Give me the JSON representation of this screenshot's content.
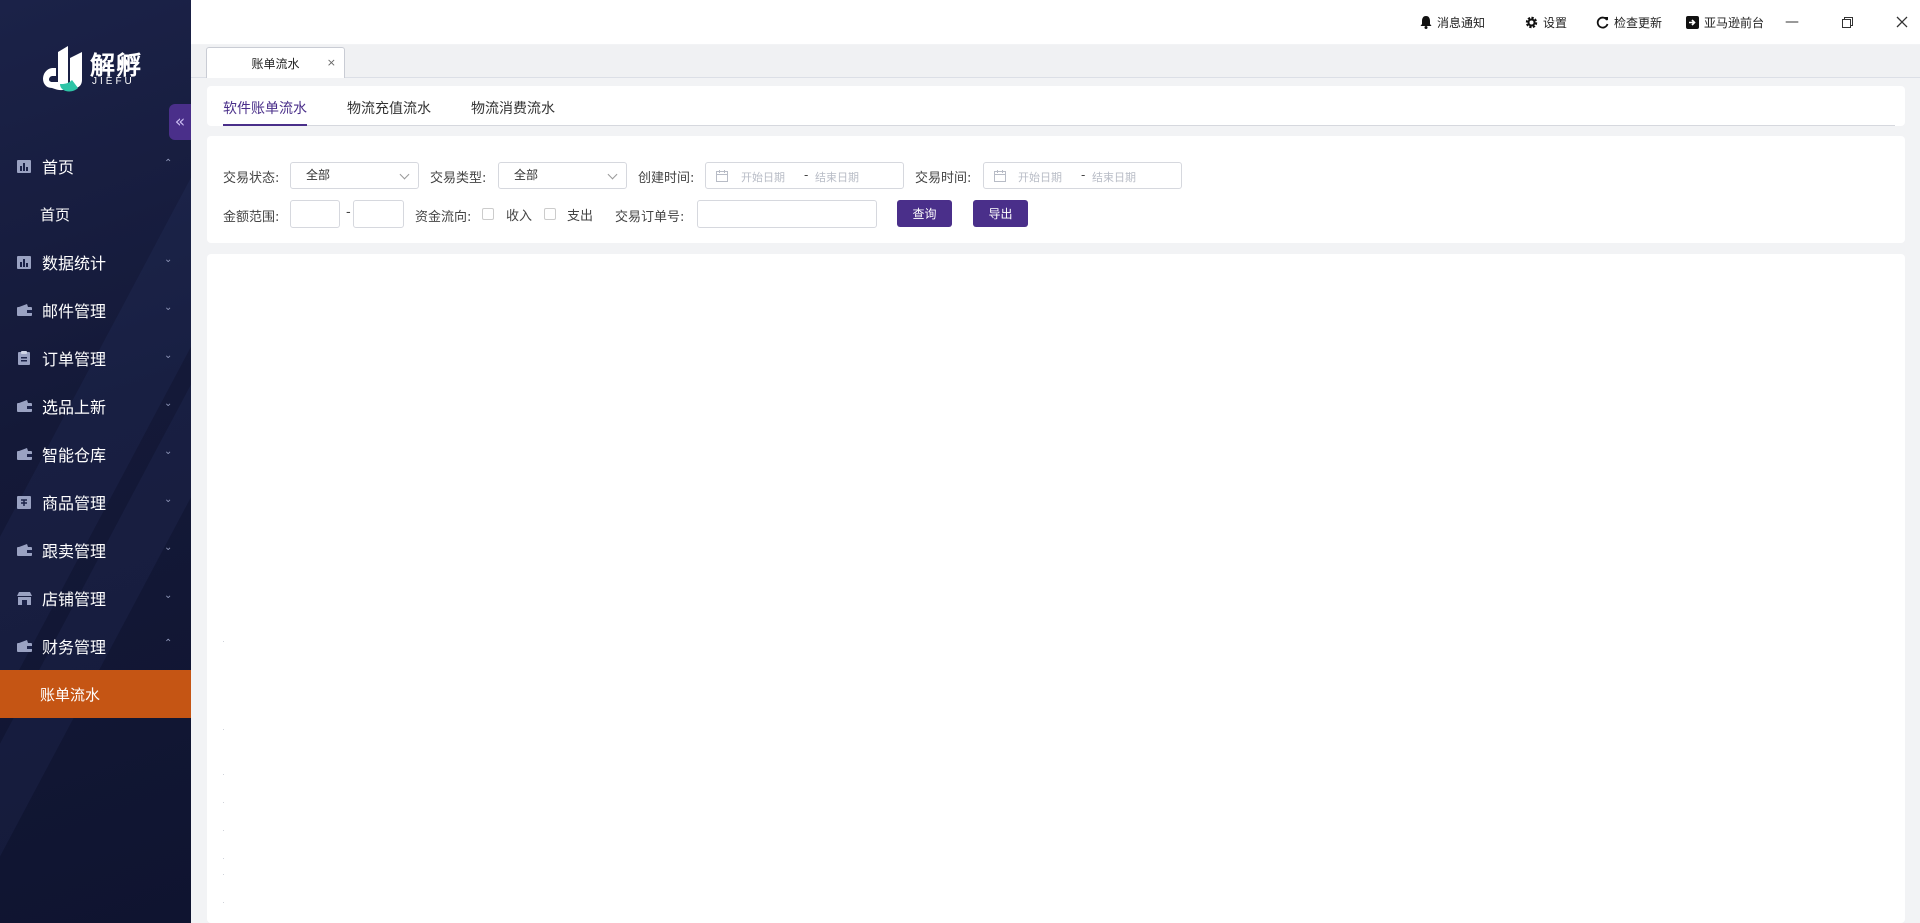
{
  "sidebar": {
    "logo": {
      "name": "解孵",
      "sub": "JIEFU"
    },
    "collapse_icon": "double-chevron-left-icon",
    "menu": [
      {
        "label": "首页",
        "icon": "bar-chart-icon",
        "expanded": true,
        "children": [
          "首页"
        ]
      },
      {
        "label": "数据统计",
        "icon": "bar-chart-icon",
        "expanded": false
      },
      {
        "label": "邮件管理",
        "icon": "wallet-icon",
        "expanded": false
      },
      {
        "label": "订单管理",
        "icon": "clipboard-icon",
        "expanded": false
      },
      {
        "label": "选品上新",
        "icon": "wallet-icon",
        "expanded": false
      },
      {
        "label": "智能仓库",
        "icon": "wallet-icon",
        "expanded": false
      },
      {
        "label": "商品管理",
        "icon": "product-icon",
        "expanded": false
      },
      {
        "label": "跟卖管理",
        "icon": "wallet-icon",
        "expanded": false
      },
      {
        "label": "店铺管理",
        "icon": "store-icon",
        "expanded": false
      },
      {
        "label": "财务管理",
        "icon": "wallet-icon",
        "expanded": true,
        "children": [
          "账单流水"
        ],
        "active_child": "账单流水"
      }
    ]
  },
  "titlebar": {
    "notifications": "消息通知",
    "settings": "设置",
    "check_update": "检查更新",
    "amazon_frontend": "亚马逊前台"
  },
  "tabs": {
    "open": [
      {
        "label": "账单流水",
        "close": "×"
      }
    ]
  },
  "subtabs": [
    {
      "label": "软件账单流水",
      "active": true
    },
    {
      "label": "物流充值流水",
      "active": false
    },
    {
      "label": "物流消费流水",
      "active": false
    }
  ],
  "filters": {
    "status_label": "交易状态:",
    "status_value": "全部",
    "type_label": "交易类型:",
    "type_value": "全部",
    "created_label": "创建时间:",
    "trade_time_label": "交易时间:",
    "start_placeholder": "开始日期",
    "end_placeholder": "结束日期",
    "date_sep": "-",
    "amount_label": "金额范围:",
    "amount_sep": "-",
    "flow_label": "资金流向:",
    "income": "收入",
    "expense": "支出",
    "order_no_label": "交易订单号:",
    "query_button": "查询",
    "export_button": "导出"
  },
  "colors": {
    "sidebar_bg": "#141938",
    "active_menu": "#c55514",
    "primary": "#4a2f8a"
  }
}
